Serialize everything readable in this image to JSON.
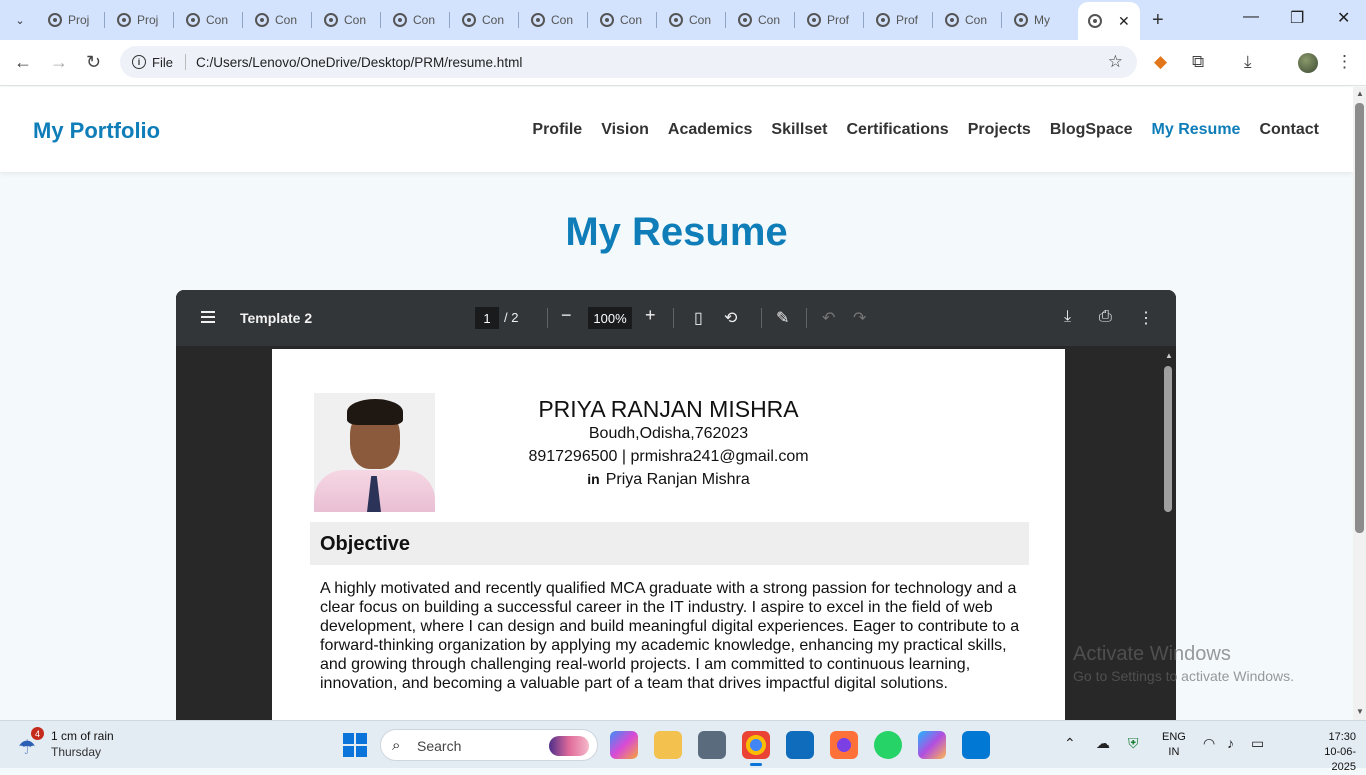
{
  "browser": {
    "tabs": [
      {
        "label": "Proj"
      },
      {
        "label": "Proj"
      },
      {
        "label": "Con"
      },
      {
        "label": "Con"
      },
      {
        "label": "Con"
      },
      {
        "label": "Con"
      },
      {
        "label": "Con"
      },
      {
        "label": "Con"
      },
      {
        "label": "Con"
      },
      {
        "label": "Con"
      },
      {
        "label": "Con"
      },
      {
        "label": "Prof"
      },
      {
        "label": "Prof"
      },
      {
        "label": "Con"
      },
      {
        "label": "My"
      }
    ],
    "active_tab_close": "✕",
    "new_tab": "+",
    "window_controls": {
      "minimize": "—",
      "maximize": "❐",
      "close": "✕"
    },
    "address": {
      "scheme_label": "File",
      "url": "C:/Users/Lenovo/OneDrive/Desktop/PRM/resume.html"
    }
  },
  "site": {
    "logo": "My Portfolio",
    "nav": [
      {
        "label": "Profile"
      },
      {
        "label": "Vision"
      },
      {
        "label": "Academics"
      },
      {
        "label": "Skillset"
      },
      {
        "label": "Certifications"
      },
      {
        "label": "Projects"
      },
      {
        "label": "BlogSpace"
      },
      {
        "label": "My Resume",
        "active": true
      },
      {
        "label": "Contact"
      }
    ],
    "page_title": "My Resume"
  },
  "pdf_viewer": {
    "title": "Template 2",
    "current_page": "1",
    "total_pages": "/  2",
    "zoom": "100%",
    "resume": {
      "name": "PRIYA RANJAN MISHRA",
      "address": "Boudh,Odisha,762023",
      "contact": "8917296500  |  prmishra241@gmail.com",
      "linkedin_icon": "in",
      "linkedin": "Priya Ranjan Mishra",
      "objective_heading": "Objective",
      "objective_text": "A highly motivated and recently qualified MCA graduate with a strong passion for technology and a clear focus on building a successful career in the IT industry. I aspire to excel in the field of web development, where I can design and build meaningful digital experiences. Eager to contribute to a forward-thinking organization by applying my academic knowledge, enhancing my practical skills, and growing through challenging real-world projects. I am committed to continuous learning, innovation, and becoming a valuable part of a team that drives impactful digital solutions."
    }
  },
  "watermark": {
    "line1": "Activate Windows",
    "line2": "Go to Settings to activate Windows."
  },
  "taskbar": {
    "weather_badge": "4",
    "weather_line1": "1 cm of rain",
    "weather_line2": "Thursday",
    "search_label": "Search",
    "lang_line1": "ENG",
    "lang_line2": "IN",
    "time": "17:30",
    "date": "10-06-2025"
  }
}
